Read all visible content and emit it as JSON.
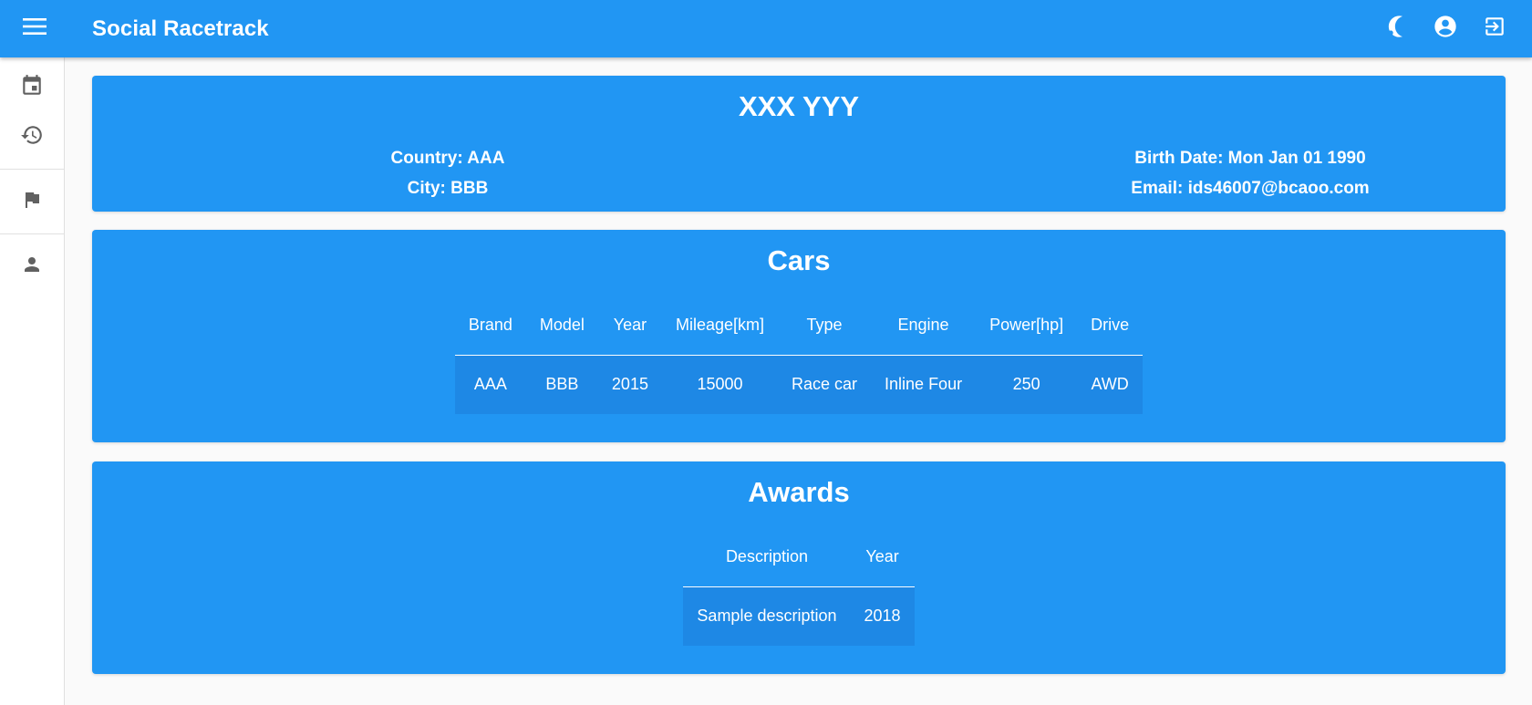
{
  "app": {
    "title": "Social Racetrack",
    "accent_color": "#2196f3"
  },
  "appbar": {
    "menu_icon": "menu-icon",
    "actions": [
      {
        "name": "theme-toggle",
        "icon": "moon-icon"
      },
      {
        "name": "account",
        "icon": "account-circle-icon"
      },
      {
        "name": "logout",
        "icon": "exit-to-app-icon"
      }
    ]
  },
  "sidebar": {
    "items": [
      {
        "name": "calendar",
        "icon": "calendar-icon"
      },
      {
        "name": "history",
        "icon": "history-icon"
      },
      {
        "name": "races",
        "icon": "flag-icon"
      },
      {
        "name": "profile",
        "icon": "person-icon"
      }
    ]
  },
  "profile": {
    "name": "XXX YYY",
    "country": "Country: AAA",
    "city": "City: BBB",
    "birth_date": "Birth Date: Mon Jan 01 1990",
    "email": "Email: ids46007@bcaoo.com"
  },
  "cars": {
    "title": "Cars",
    "columns": [
      "Brand",
      "Model",
      "Year",
      "Mileage[km]",
      "Type",
      "Engine",
      "Power[hp]",
      "Drive"
    ],
    "rows": [
      [
        "AAA",
        "BBB",
        "2015",
        "15000",
        "Race car",
        "Inline Four",
        "250",
        "AWD"
      ]
    ]
  },
  "awards": {
    "title": "Awards",
    "columns": [
      "Description",
      "Year"
    ],
    "rows": [
      [
        "Sample description",
        "2018"
      ]
    ]
  }
}
